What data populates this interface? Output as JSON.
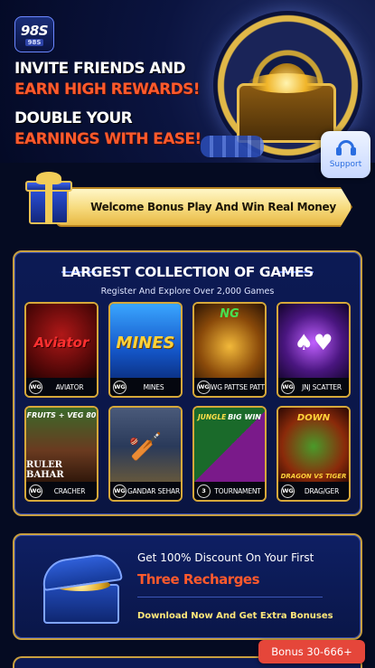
{
  "hero": {
    "logo_main": "98S",
    "logo_sub": "98S",
    "line1": "INVITE FRIENDS AND",
    "line2": "EARN HIGH REWARDS!",
    "line3": "DOUBLE YOUR",
    "line4": "EARNINGS WITH EASE!",
    "support_label": "Support",
    "support_icon": "headset-icon"
  },
  "welcome": {
    "label": "Welcome Bonus Play And Win Real Money",
    "icon": "gift-box-icon"
  },
  "games_panel": {
    "title": "LARGEST COLLECTION OF GAMES",
    "subtitle": "Register And Explore Over 2,000 Games",
    "tiles": [
      {
        "badge": "WG",
        "name": "AVIATOR",
        "art": "Aviator"
      },
      {
        "badge": "WG",
        "name": "MINES",
        "art": "MINES"
      },
      {
        "badge": "WG",
        "name": "WG PATTSE PATTI",
        "art": "NG"
      },
      {
        "badge": "WG",
        "name": "JNJ SCATTER",
        "art": ""
      },
      {
        "badge": "WG",
        "name": "CRACHER",
        "art_top": "FRUITS + VEG 80",
        "art_bottom": "RULER BAHAR"
      },
      {
        "badge": "WG",
        "name": "GANDAR SEHAR",
        "art": ""
      },
      {
        "badge": "3",
        "name": "TOURNAMENT",
        "art_top": "JUNGLE",
        "art_right": "BIG WIN"
      },
      {
        "badge": "WG",
        "name": "DRAG/GER",
        "art_top": "DOWN",
        "art_bottom": "DRAGON VS TIGER"
      }
    ]
  },
  "recharge": {
    "line1": "Get 100% Discount On Your First",
    "line2": "Three Recharges",
    "line3": "Download Now And Get Extra Bonuses"
  },
  "bonus_button": {
    "label": "Bonus 30-666+"
  },
  "colors": {
    "accent_orange": "#ff5a2c",
    "gold_border": "#c9a040",
    "panel_blue": "#0c1a55",
    "bonus_red": "#e5463a"
  }
}
